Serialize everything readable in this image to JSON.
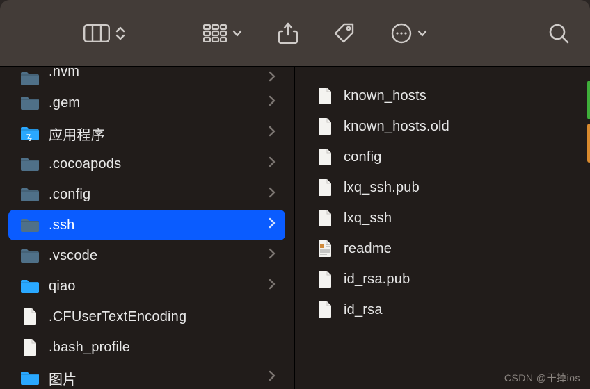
{
  "toolbar": {
    "view_switcher": "columns-view",
    "group_menu": "group-by",
    "share": "share",
    "tags": "tags",
    "actions": "actions",
    "search": "search"
  },
  "left": [
    {
      "name": ".nvm",
      "kind": "folder",
      "color": "#4f7088",
      "arrow": true,
      "cut": true
    },
    {
      "name": ".gem",
      "kind": "folder",
      "color": "#4f7088",
      "arrow": true
    },
    {
      "name": "应用程序",
      "kind": "folder",
      "color": "#2aa8ff",
      "arrow": true,
      "special": "apps"
    },
    {
      "name": ".cocoapods",
      "kind": "folder",
      "color": "#4f7088",
      "arrow": true
    },
    {
      "name": ".config",
      "kind": "folder",
      "color": "#4f7088",
      "arrow": true
    },
    {
      "name": ".ssh",
      "kind": "folder",
      "color": "#4f7088",
      "arrow": true,
      "selected": true
    },
    {
      "name": ".vscode",
      "kind": "folder",
      "color": "#4f7088",
      "arrow": true
    },
    {
      "name": "qiao",
      "kind": "folder",
      "color": "#2aa8ff",
      "arrow": true
    },
    {
      "name": ".CFUserTextEncoding",
      "kind": "file",
      "color": "#a9a6a2"
    },
    {
      "name": ".bash_profile",
      "kind": "file",
      "color": "#a9a6a2"
    },
    {
      "name": "图片",
      "kind": "folder",
      "color": "#2aa8ff",
      "arrow": true,
      "cutbottom": true
    }
  ],
  "right": [
    {
      "name": "known_hosts",
      "kind": "file"
    },
    {
      "name": "known_hosts.old",
      "kind": "file"
    },
    {
      "name": "config",
      "kind": "file"
    },
    {
      "name": "lxq_ssh.pub",
      "kind": "file"
    },
    {
      "name": "lxq_ssh",
      "kind": "file"
    },
    {
      "name": "readme",
      "kind": "richfile"
    },
    {
      "name": "id_rsa.pub",
      "kind": "file"
    },
    {
      "name": "id_rsa",
      "kind": "file"
    }
  ],
  "watermark": "CSDN @干掉ios"
}
